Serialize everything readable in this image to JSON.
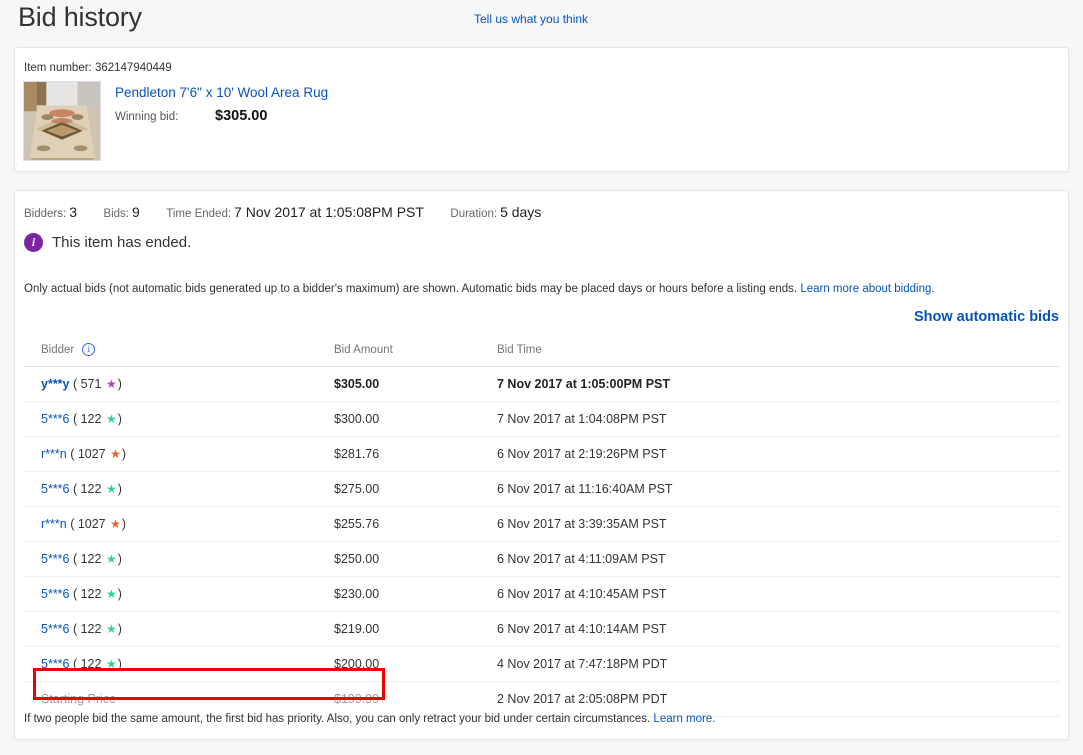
{
  "header": {
    "title": "Bid history",
    "feedback_link": "Tell us what you think"
  },
  "item": {
    "item_number_label": "Item number: 362147940449",
    "title": "Pendleton 7'6\" x 10' Wool Area Rug",
    "winning_bid_label": "Winning bid:",
    "winning_bid_value": "$305.00"
  },
  "summary": {
    "bidders_label": "Bidders:",
    "bidders_value": "3",
    "bids_label": "Bids:",
    "bids_value": "9",
    "time_ended_label": "Time Ended:",
    "time_ended_value": "7 Nov 2017 at 1:05:08PM PST",
    "duration_label": "Duration:",
    "duration_value": "5 days",
    "ended_message": "This item has ended.",
    "info_icon": "info-circle-icon"
  },
  "disclaimer": {
    "text": "Only actual bids (not automatic bids generated up to a bidder's maximum) are shown. Automatic bids may be placed days or hours before a listing ends.",
    "link": "Learn more about bidding."
  },
  "actions": {
    "show_automatic_bids": "Show automatic bids"
  },
  "table": {
    "headers": {
      "bidder": "Bidder",
      "bid_amount": "Bid Amount",
      "bid_time": "Bid Time"
    },
    "bidder_info_icon": "info-circle-icon",
    "rows": [
      {
        "bidder": "y***y",
        "feedback": "571",
        "star_color": "#b043c4",
        "amount": "$305.00",
        "time": "7 Nov 2017 at 1:05:00PM PST",
        "highlight": false
      },
      {
        "bidder": "5***6",
        "feedback": "122",
        "star_color": "#2fd1a8",
        "amount": "$300.00",
        "time": "7 Nov 2017 at 1:04:08PM PST",
        "highlight": false
      },
      {
        "bidder": "r***n",
        "feedback": "1027",
        "star_color": "#e8602c",
        "amount": "$281.76",
        "time": "6 Nov 2017 at 2:19:26PM PST",
        "highlight": false
      },
      {
        "bidder": "5***6",
        "feedback": "122",
        "star_color": "#2fd1a8",
        "amount": "$275.00",
        "time": "6 Nov 2017 at 11:16:40AM PST",
        "highlight": false
      },
      {
        "bidder": "r***n",
        "feedback": "1027",
        "star_color": "#e8602c",
        "amount": "$255.76",
        "time": "6 Nov 2017 at 3:39:35AM PST",
        "highlight": false
      },
      {
        "bidder": "5***6",
        "feedback": "122",
        "star_color": "#2fd1a8",
        "amount": "$250.00",
        "time": "6 Nov 2017 at 4:11:09AM PST",
        "highlight": false
      },
      {
        "bidder": "5***6",
        "feedback": "122",
        "star_color": "#2fd1a8",
        "amount": "$230.00",
        "time": "6 Nov 2017 at 4:10:45AM PST",
        "highlight": false
      },
      {
        "bidder": "5***6",
        "feedback": "122",
        "star_color": "#2fd1a8",
        "amount": "$219.00",
        "time": "6 Nov 2017 at 4:10:14AM PST",
        "highlight": false
      },
      {
        "bidder": "5***6",
        "feedback": "122",
        "star_color": "#2fd1a8",
        "amount": "$200.00",
        "time": "4 Nov 2017 at 7:47:18PM PDT",
        "highlight": false
      }
    ],
    "starting_price_row": {
      "label": "Starting Price",
      "amount": "$199.99",
      "time": "2 Nov 2017 at 2:05:08PM PDT",
      "highlight_color": "#ee0000"
    }
  },
  "footer": {
    "text": "If two people bid the same amount, the first bid has priority. Also, you can only retract your bid under certain circumstances.",
    "link": "Learn more."
  }
}
